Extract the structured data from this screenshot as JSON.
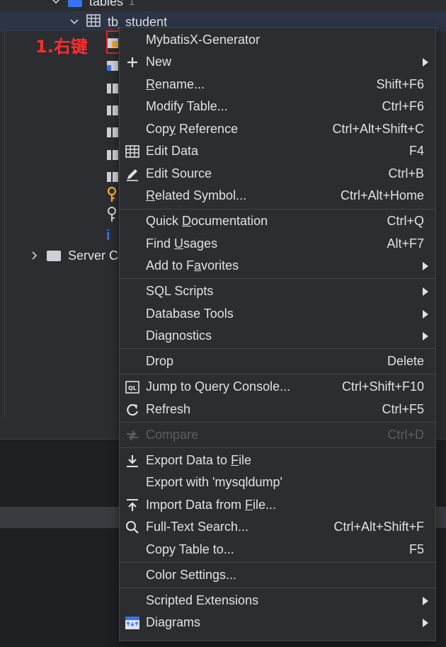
{
  "tree": {
    "tables_label": "tables",
    "tables_count": "1",
    "table_name": "tb_student",
    "server_label": "Server C"
  },
  "annotation": "1.右键",
  "menu": {
    "items": [
      {
        "label": "MybatisX-Generator",
        "shortcut": "",
        "submenu": false
      },
      {
        "label": "New",
        "shortcut": "",
        "submenu": true
      },
      {
        "label": "Rename...",
        "shortcut": "Shift+F6",
        "submenu": false
      },
      {
        "label": "Modify Table...",
        "shortcut": "Ctrl+F6",
        "submenu": false
      },
      {
        "label": "Copy Reference",
        "shortcut": "Ctrl+Alt+Shift+C",
        "submenu": false
      },
      {
        "label": "Edit Data",
        "shortcut": "F4",
        "submenu": false
      },
      {
        "label": "Edit Source",
        "shortcut": "Ctrl+B",
        "submenu": false
      },
      {
        "label": "Related Symbol...",
        "shortcut": "Ctrl+Alt+Home",
        "submenu": false
      },
      {
        "label": "Quick Documentation",
        "shortcut": "Ctrl+Q",
        "submenu": false
      },
      {
        "label": "Find Usages",
        "shortcut": "Alt+F7",
        "submenu": false
      },
      {
        "label": "Add to Favorites",
        "shortcut": "",
        "submenu": true
      },
      {
        "label": "SQL Scripts",
        "shortcut": "",
        "submenu": true
      },
      {
        "label": "Database Tools",
        "shortcut": "",
        "submenu": true
      },
      {
        "label": "Diagnostics",
        "shortcut": "",
        "submenu": true
      },
      {
        "label": "Drop",
        "shortcut": "Delete",
        "submenu": false
      },
      {
        "label": "Jump to Query Console...",
        "shortcut": "Ctrl+Shift+F10",
        "submenu": false
      },
      {
        "label": "Refresh",
        "shortcut": "Ctrl+F5",
        "submenu": false
      },
      {
        "label": "Compare",
        "shortcut": "Ctrl+D",
        "submenu": false,
        "disabled": true
      },
      {
        "label": "Export Data to File",
        "shortcut": "",
        "submenu": false
      },
      {
        "label": "Export with 'mysqldump'",
        "shortcut": "",
        "submenu": false
      },
      {
        "label": "Import Data from File...",
        "shortcut": "",
        "submenu": false
      },
      {
        "label": "Full-Text Search...",
        "shortcut": "Ctrl+Alt+Shift+F",
        "submenu": false
      },
      {
        "label": "Copy Table to...",
        "shortcut": "F5",
        "submenu": false
      },
      {
        "label": "Color Settings...",
        "shortcut": "",
        "submenu": false
      },
      {
        "label": "Scripted Extensions",
        "shortcut": "",
        "submenu": true
      },
      {
        "label": "Diagrams",
        "shortcut": "",
        "submenu": true
      }
    ]
  },
  "colors": {
    "annotation": "#ff2d2d",
    "highlight_border": "#e5232a",
    "menu_bg": "#2b2d30",
    "accent_blue": "#3574f0"
  }
}
